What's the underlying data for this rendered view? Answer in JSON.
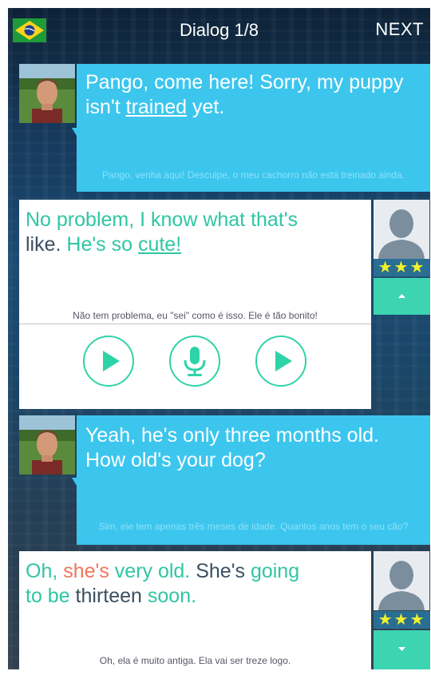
{
  "header": {
    "flag_icon": "brazil-flag-icon",
    "title": "Dialog 1/8",
    "next_label": "NEXT"
  },
  "colors": {
    "blue_bubble": "#3cc6ee",
    "accent_green": "#2fc6a4",
    "highlight_red": "#f0765a",
    "stars": "#f2f22a"
  },
  "dialog": [
    {
      "speaker": "tutor",
      "en_before": "Pango, come here! Sorry, my puppy isn't ",
      "en_link": "trained",
      "en_after": " yet.",
      "pt": "Pango, venha aqui! Desculpe, o meu cachorro não está treinado ainda."
    },
    {
      "speaker": "user",
      "en_part1": "No problem, I know what that's",
      "en_part2": "like.",
      "en_part3": " He's so ",
      "en_link": "cute!",
      "pt": "Não tem problema, eu \"sei\" como é isso. Ele é tão bonito!",
      "stars": "★★★",
      "controls": [
        "play-icon",
        "microphone-icon",
        "play-icon"
      ]
    },
    {
      "speaker": "tutor",
      "en": "Yeah, he's only three months old. How old's your dog?",
      "pt": "Sim, ele tem apenas três meses de idade. Quantos anos tem o seu cão?"
    },
    {
      "speaker": "user",
      "w1": "Oh, ",
      "w2": "she's",
      "w3": " very old.",
      "w4": " She's ",
      "w5": "going",
      "w6": "to be",
      "w7": " thirteen ",
      "w8": "soon.",
      "pt": "Oh, ela é muito antiga. Ela vai ser treze logo.",
      "stars": "★★★"
    }
  ]
}
